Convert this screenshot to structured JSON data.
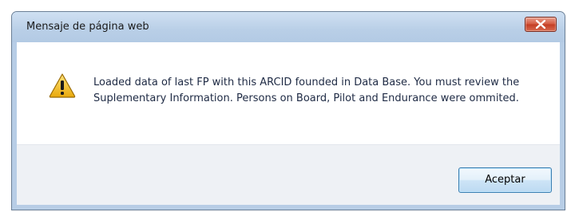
{
  "dialog": {
    "title": "Mensaje de página web",
    "message": "Loaded data of last FP with this ARCID founded in Data Base. You must review the Suplementary Information. Persons on Board, Pilot and Endurance were ommited.",
    "icon": "warning-icon",
    "close_icon": "close-icon",
    "ok_label": "Aceptar"
  },
  "colors": {
    "titlebar": "#b9cfe7",
    "close_button": "#c33c22",
    "warning_fill": "#f5c518",
    "footer": "#eef1f5"
  }
}
